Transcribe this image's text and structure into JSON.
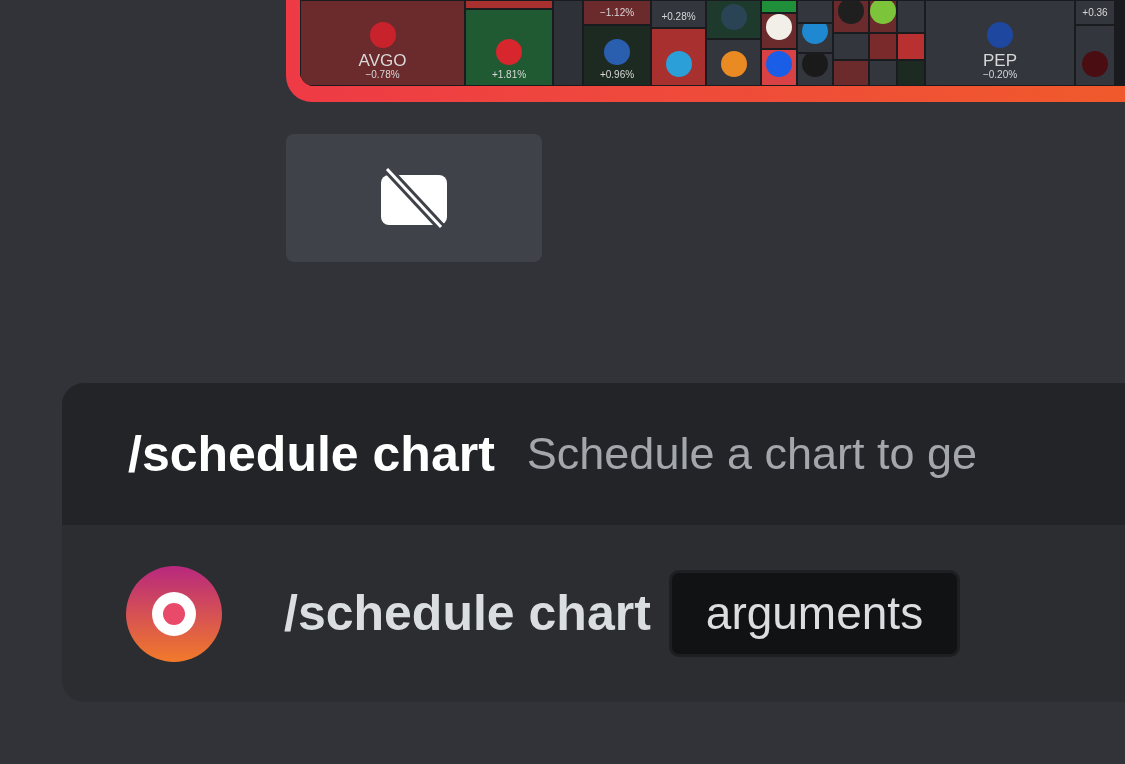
{
  "heatmap": {
    "tiles": [
      {
        "ticker": "AVGO",
        "change": "−0.78%",
        "color": "#6b2a2c"
      },
      {
        "change": "+1.81%",
        "color": "#1f5a32"
      },
      {
        "change": "−1.12%",
        "color": "#6b2a2c"
      },
      {
        "change": "+0.96%",
        "color": "#1c2a22"
      },
      {
        "change": "+0.28%",
        "color": "#33363d"
      },
      {
        "ticker": "PEP",
        "change": "−0.20%",
        "color": "#33363d"
      },
      {
        "change": "+0.36",
        "color": "#33363d"
      }
    ]
  },
  "video_button": {
    "on": false
  },
  "command": {
    "name": "/schedule chart",
    "description": "Schedule a chart to ge",
    "entry": {
      "name": "/schedule chart",
      "option": "arguments"
    }
  }
}
